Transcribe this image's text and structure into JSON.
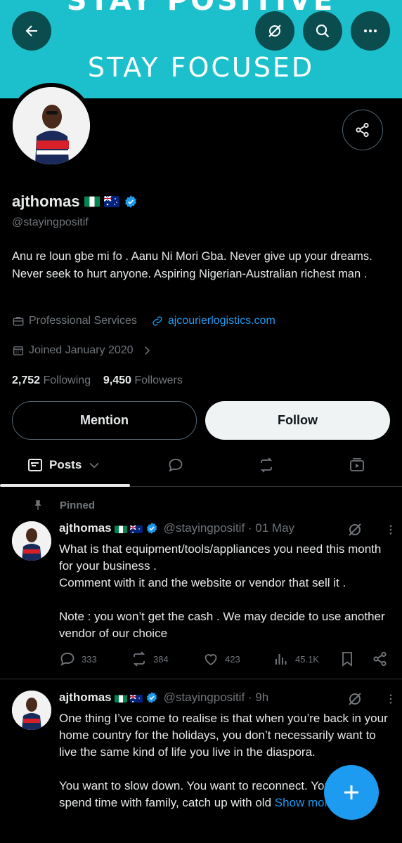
{
  "banner": {
    "text_top": "STAY POSITIVE",
    "text_main": "STAY FOCUSED",
    "color": "#1cc0cc"
  },
  "header": {
    "back_icon": "arrow-left-icon",
    "actions": [
      "translate-icon",
      "search-icon",
      "more-icon"
    ]
  },
  "profile": {
    "name": "ajthomas",
    "handle": "@stayingpositif",
    "bio": "Anu re loun gbe mi fo . Aanu Ni Mori Gba. Never give up your dreams. Never seek to hurt anyone. Aspiring Nigerian-Australian richest man .",
    "category": "Professional Services",
    "website": "ajcourierlogistics.com",
    "joined": "Joined January 2020",
    "following_count": "2,752",
    "following_label": "Following",
    "followers_count": "9,450",
    "followers_label": "Followers",
    "mention_label": "Mention",
    "follow_label": "Follow"
  },
  "tabs": {
    "posts_label": "Posts"
  },
  "pinned_label": "Pinned",
  "tweets": [
    {
      "name": "ajthomas",
      "meta": "@stayingpositif · 01 May",
      "body": "What is that equipment/tools/appliances  you need this month  for your business .\nComment with it and the website or vendor that sell it .\n\nNote : you won’t get the cash . We may decide to use another vendor of our choice",
      "replies": "333",
      "reposts": "384",
      "likes": "423",
      "views": "45.1K"
    },
    {
      "name": "ajthomas",
      "meta": "@stayingpositif · 9h",
      "body": "One thing I’ve come to realise is that when you’re back in your home country for the holidays, you don’t necessarily want to live the same kind of life you live in the diaspora.\n\nYou want to slow down. You want to reconnect. You want to spend time with family, catch up with old ",
      "show_more": "Show more"
    }
  ],
  "colors": {
    "accent": "#1d9bf0",
    "background": "#000000",
    "muted": "#71767b"
  }
}
